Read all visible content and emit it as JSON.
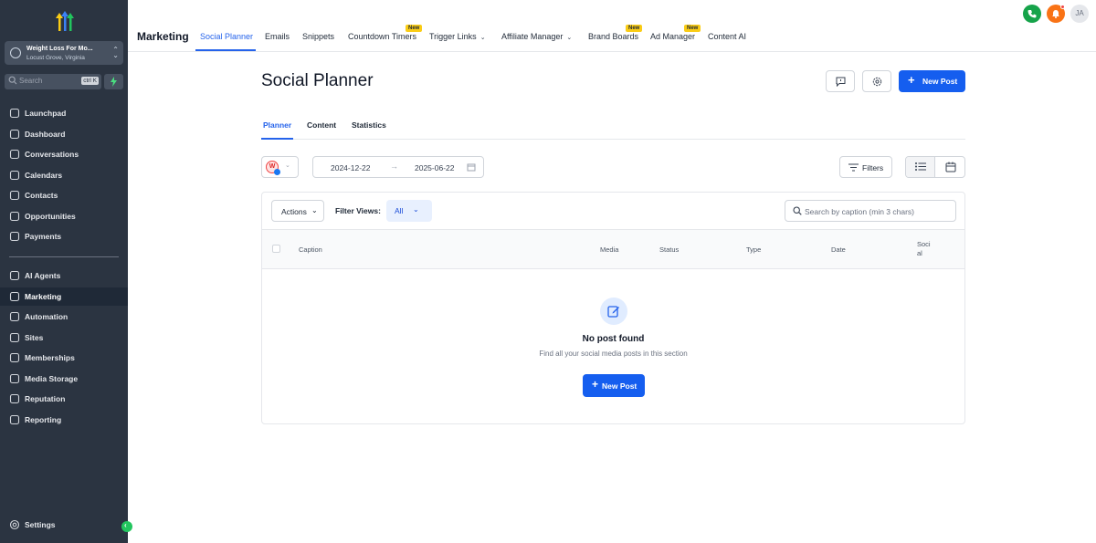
{
  "sidebar": {
    "account_name": "Weight Loss For Mo...",
    "account_location": "Locust Grove, Virginia",
    "search_placeholder": "Search",
    "search_shortcut": "ctrl K",
    "items": [
      {
        "label": "Launchpad",
        "icon": "launchpad-icon"
      },
      {
        "label": "Dashboard",
        "icon": "dashboard-icon"
      },
      {
        "label": "Conversations",
        "icon": "chat-icon"
      },
      {
        "label": "Calendars",
        "icon": "calendar-icon"
      },
      {
        "label": "Contacts",
        "icon": "contacts-icon"
      },
      {
        "label": "Opportunities",
        "icon": "opportunities-icon"
      },
      {
        "label": "Payments",
        "icon": "payments-icon"
      },
      {
        "label": "AI Agents",
        "icon": "sparkles-icon"
      },
      {
        "label": "Marketing",
        "icon": "send-icon"
      },
      {
        "label": "Automation",
        "icon": "automation-icon"
      },
      {
        "label": "Sites",
        "icon": "sites-icon"
      },
      {
        "label": "Memberships",
        "icon": "award-icon"
      },
      {
        "label": "Media Storage",
        "icon": "image-icon"
      },
      {
        "label": "Reputation",
        "icon": "star-icon"
      },
      {
        "label": "Reporting",
        "icon": "trend-icon"
      }
    ],
    "settings_label": "Settings",
    "active_item": "Marketing"
  },
  "topnav": {
    "section_title": "Marketing",
    "tabs": [
      {
        "label": "Social Planner",
        "active": true
      },
      {
        "label": "Emails"
      },
      {
        "label": "Snippets"
      },
      {
        "label": "Countdown Timers",
        "badge": "New"
      },
      {
        "label": "Trigger Links",
        "dropdown": true
      },
      {
        "label": "Affiliate Manager",
        "dropdown": true
      },
      {
        "label": "Brand Boards",
        "badge": "New"
      },
      {
        "label": "Ad Manager",
        "badge": "New"
      },
      {
        "label": "Content AI"
      }
    ],
    "user_initials": "JA"
  },
  "main": {
    "title": "Social Planner",
    "new_post_label": "New Post",
    "subtabs": [
      "Planner",
      "Content",
      "Statistics"
    ],
    "account_avatar_letter": "W",
    "date_start": "2024-12-22",
    "date_end": "2025-06-22",
    "filters_label": "Filters",
    "actions_label": "Actions",
    "filter_views_label": "Filter Views:",
    "filter_views_value": "All",
    "search_placeholder": "Search by caption (min 3 chars)",
    "columns": [
      "Caption",
      "Media",
      "Status",
      "Type",
      "Date",
      "Soci al"
    ],
    "empty_title": "No post found",
    "empty_subtitle": "Find all your social media posts in this section"
  },
  "colors": {
    "sidebar_bg": "#2b3441",
    "accent": "#155eef",
    "badge": "#facc15"
  }
}
